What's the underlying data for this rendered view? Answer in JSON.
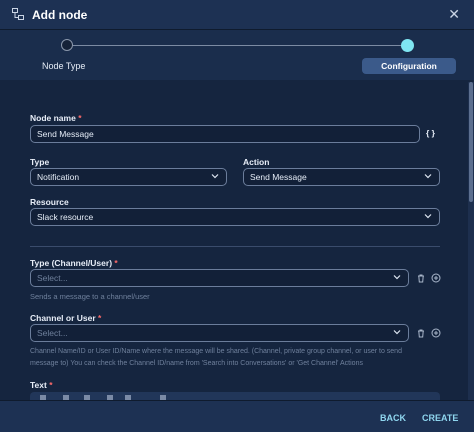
{
  "header": {
    "title": "Add node",
    "icon": "node-icon",
    "close_icon": "close-icon"
  },
  "stepper": {
    "steps": [
      "Node Type",
      "Configuration"
    ],
    "active_step": "Configuration"
  },
  "form": {
    "node_name": {
      "label": "Node name",
      "required_mark": "*",
      "value": "Send Message",
      "suffix": "{ }"
    },
    "type": {
      "label": "Type",
      "value": "Notification"
    },
    "action": {
      "label": "Action",
      "value": "Send Message"
    },
    "resource": {
      "label": "Resource",
      "value": "Slack resource"
    },
    "type_channel_user": {
      "label": "Type (Channel/User)",
      "required_mark": "*",
      "placeholder": "Select...",
      "helper": "Sends a message to a channel/user"
    },
    "channel_or_user": {
      "label": "Channel or User",
      "required_mark": "*",
      "placeholder": "Select...",
      "helper_line1": "Channel Name/ID or User ID/Name where the message will be shared. (Channel, private group channel, or user to send",
      "helper_line2": "message to) You can check the Channel ID/name from 'Search into Conversations' or 'Get Channel' Actions"
    },
    "text": {
      "label": "Text",
      "required_mark": "*"
    }
  },
  "footer": {
    "back_label": "BACK",
    "create_label": "CREATE"
  },
  "colors": {
    "accent": "#7fe6f2",
    "required": "#ff6b6b",
    "button_text": "#8fd6ef"
  }
}
